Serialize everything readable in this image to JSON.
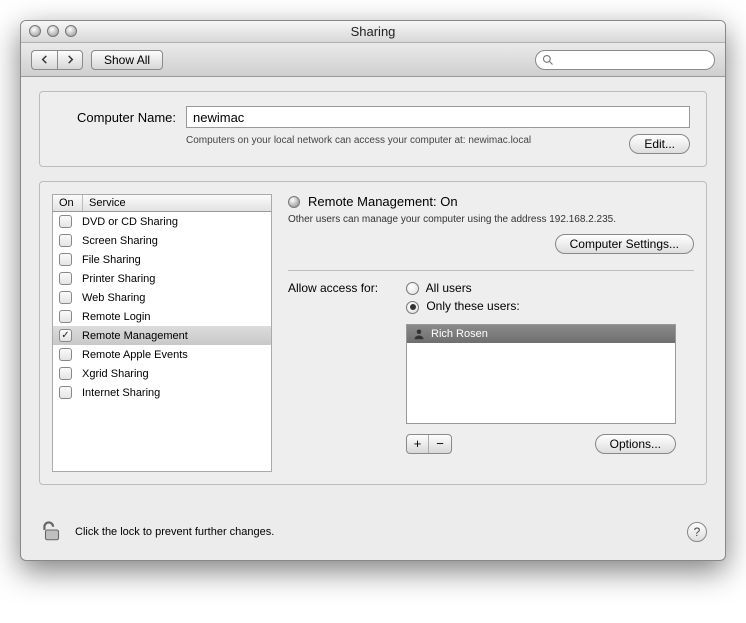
{
  "window": {
    "title": "Sharing"
  },
  "toolbar": {
    "show_all": "Show All",
    "search_placeholder": ""
  },
  "computer_name": {
    "label": "Computer Name:",
    "value": "newimac",
    "hint": "Computers on your local network can access your computer at: newimac.local",
    "edit": "Edit..."
  },
  "services": {
    "header_on": "On",
    "header_service": "Service",
    "items": [
      {
        "label": "DVD or CD Sharing",
        "on": false,
        "selected": false
      },
      {
        "label": "Screen Sharing",
        "on": false,
        "selected": false
      },
      {
        "label": "File Sharing",
        "on": false,
        "selected": false
      },
      {
        "label": "Printer Sharing",
        "on": false,
        "selected": false
      },
      {
        "label": "Web Sharing",
        "on": false,
        "selected": false
      },
      {
        "label": "Remote Login",
        "on": false,
        "selected": false
      },
      {
        "label": "Remote Management",
        "on": true,
        "selected": true
      },
      {
        "label": "Remote Apple Events",
        "on": false,
        "selected": false
      },
      {
        "label": "Xgrid Sharing",
        "on": false,
        "selected": false
      },
      {
        "label": "Internet Sharing",
        "on": false,
        "selected": false
      }
    ]
  },
  "detail": {
    "status": "Remote Management: On",
    "description": "Other users can manage your computer using the address 192.168.2.235.",
    "computer_settings": "Computer Settings...",
    "access_label": "Allow access for:",
    "radio_all": "All users",
    "radio_only": "Only these users:",
    "users": [
      "Rich Rosen"
    ],
    "options": "Options..."
  },
  "footer": {
    "lock_text": "Click the lock to prevent further changes."
  }
}
